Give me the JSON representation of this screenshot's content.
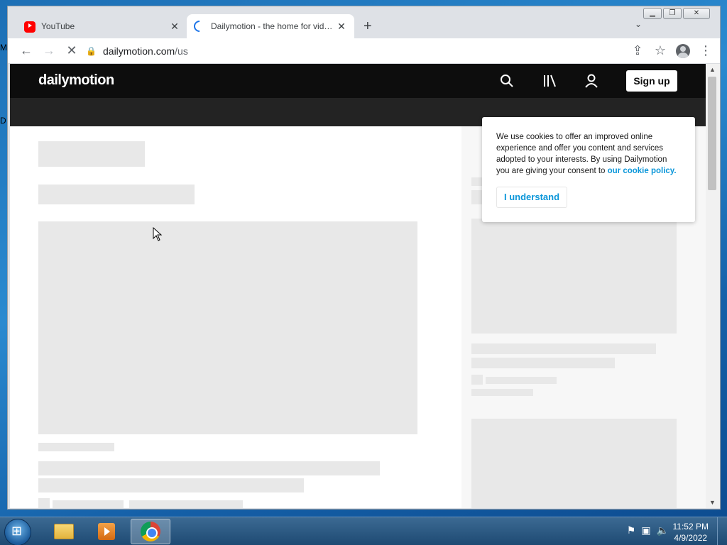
{
  "desktop": {
    "edge_glyph_1": "M",
    "edge_glyph_2": "D"
  },
  "browser": {
    "tabs": [
      {
        "title": "YouTube",
        "favicon": "youtube-logo-icon"
      },
      {
        "title": "Dailymotion - the home for videos",
        "favicon": "loading-spinner-icon"
      }
    ],
    "close_glyph": "✕",
    "new_tab_glyph": "+",
    "tab_search_glyph": "⌄",
    "window_controls": {
      "minimize": "▁",
      "restore": "❐",
      "close": "✕"
    },
    "nav": {
      "back": "←",
      "forward": "→",
      "stop": "✕"
    },
    "address": {
      "host": "dailymotion.com",
      "path": "/us",
      "lock_icon": "lock-icon"
    },
    "toolbar_icons": {
      "share": "⇪",
      "bookmark": "☆",
      "menu": "⋮"
    }
  },
  "page": {
    "logo": "dailymotion",
    "signup_label": "Sign up",
    "cookie": {
      "text": "We use cookies to offer an improved online experience and offer you content and services adopted to your interests. By using Dailymotion you are giving your consent to ",
      "link": "our cookie policy.",
      "button": "I understand"
    }
  },
  "scrollbar": {
    "up": "▲",
    "down": "▼"
  },
  "taskbar": {
    "apps": [
      "windows-explorer",
      "media-player",
      "google-chrome"
    ],
    "tray": {
      "action_center": "⚑",
      "network": "▣",
      "volume": "🔈"
    },
    "clock": {
      "time": "11:52 PM",
      "date": "4/9/2022"
    }
  },
  "colors": {
    "accent": "#0a96d9",
    "header": "#0d0d0d",
    "skeleton": "#e8e8e8"
  }
}
